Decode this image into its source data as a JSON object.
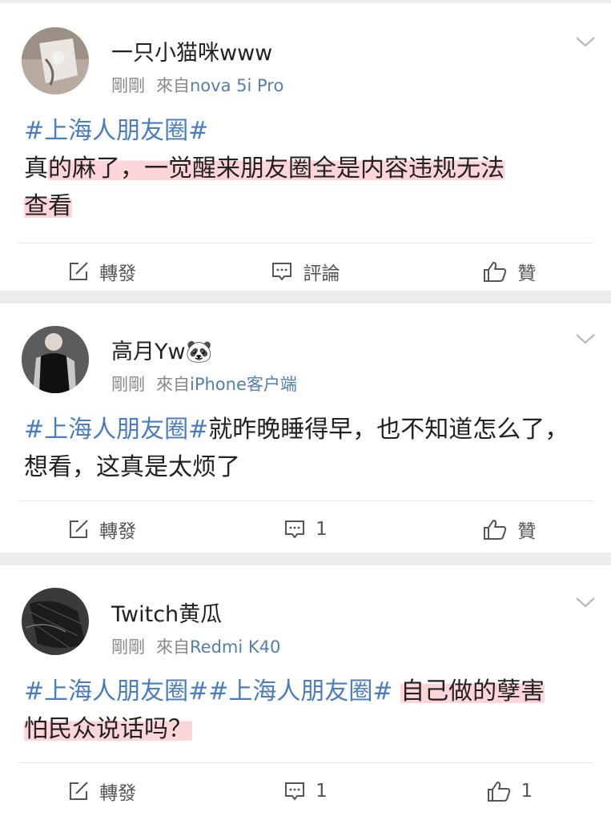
{
  "colors": {
    "hashtag": "#4a7cc0",
    "source": "#557fa8",
    "highlight": "#fcb4bc",
    "background": "#ececec"
  },
  "posts": [
    {
      "username": "一只小猫咪www",
      "time": "剛剛",
      "source_prefix": "來自",
      "source": "nova 5i Pro",
      "hashtags": "#上海人朋友圈#",
      "text_line1_prefix": "真",
      "text_line1_highlight": "的麻了，一觉醒来朋友圈全是内容违规无法",
      "text_line2_highlight": "查看",
      "repost_label": "轉發",
      "comment_label": "評論",
      "like_label": "贊"
    },
    {
      "username": "高月Yw",
      "username_emoji": "🐼",
      "time": "剛剛",
      "source_prefix": "來自",
      "source": "iPhone客户端",
      "hashtags": "#上海人朋友圈#",
      "text": "就昨晚睡得早，也不知道怎么了，想看，这真是太烦了",
      "repost_label": "轉發",
      "comment_label": "1",
      "like_label": "贊"
    },
    {
      "username": "Twitch黄瓜",
      "time": "剛剛",
      "source_prefix": "來自",
      "source": "Redmi K40",
      "hashtags": "#上海人朋友圈##上海人朋友圈#",
      "text_line1_highlight": "自己做的孽害",
      "text_line2_highlight": "怕民众说话吗？",
      "repost_label": "轉發",
      "comment_label": "1",
      "like_label": "1"
    }
  ]
}
